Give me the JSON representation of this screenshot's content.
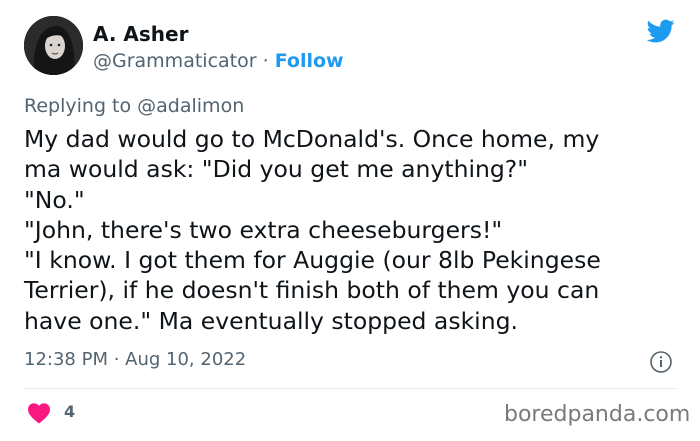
{
  "author": {
    "name": "A. Asher",
    "handle": "@Grammaticator",
    "separator": "·",
    "follow_label": "Follow"
  },
  "reply": {
    "prefix": "Replying to ",
    "mention": "@adalimon"
  },
  "body_lines": [
    "My dad would go to McDonald's. Once home, my",
    "ma would ask: \"Did you get me anything?\"",
    "\"No.\"",
    "\"John, there's two extra cheeseburgers!\"",
    "\"I know. I got them for Auggie (our 8lb Pekingese",
    "Terrier), if he doesn't finish both of them you can",
    "have one.\" Ma eventually stopped asking."
  ],
  "timestamp": "12:38 PM · Aug 10, 2022",
  "likes": "4",
  "watermark": "boredpanda.com",
  "icons": {
    "brand": "twitter-bird-icon",
    "info": "info-icon",
    "like": "heart-icon"
  },
  "colors": {
    "accent": "#1d9bf0",
    "like": "#f91880",
    "secondary_text": "#536471",
    "primary_text": "#0f1419"
  }
}
